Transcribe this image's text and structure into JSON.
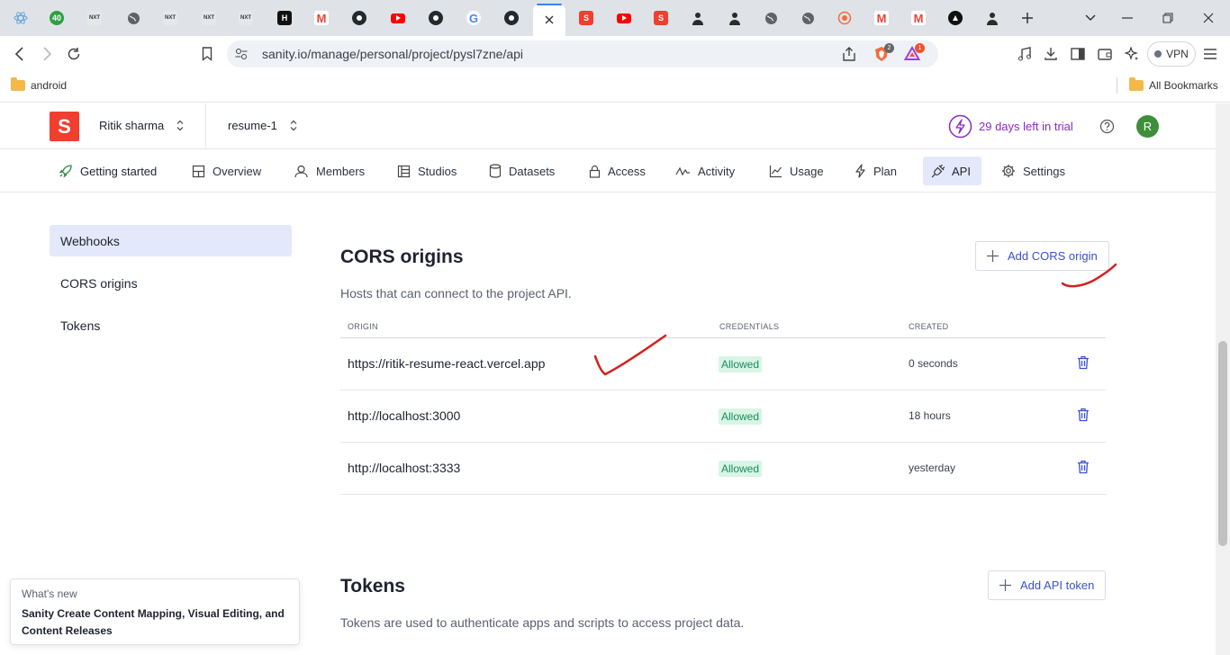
{
  "browser": {
    "tabs": [
      {
        "icon": "react-icon",
        "color": "#61a8d8"
      },
      {
        "icon": "counter-badge-icon",
        "color": "#2ea043",
        "text": "40"
      },
      {
        "icon": "next-favicon-icon",
        "color": "#e5e7eb",
        "text": "NXT"
      },
      {
        "icon": "globe-icon",
        "color": "#5f6368"
      },
      {
        "icon": "next-favicon-icon",
        "color": "#e5e7eb",
        "text": "NXT"
      },
      {
        "icon": "next-favicon-icon",
        "color": "#e5e7eb",
        "text": "NXT"
      },
      {
        "icon": "next-favicon-icon",
        "color": "#e5e7eb",
        "text": "NXT"
      },
      {
        "icon": "hackernoon-icon",
        "color": "#111111",
        "text": "H"
      },
      {
        "icon": "gmail-icon",
        "color": "#ea4335",
        "text": "M"
      },
      {
        "icon": "github-icon",
        "color": "#24292f"
      },
      {
        "icon": "youtube-icon",
        "color": "#ff0000"
      },
      {
        "icon": "github-icon",
        "color": "#24292f"
      },
      {
        "icon": "google-icon",
        "color": "#4285f4",
        "text": "G"
      },
      {
        "icon": "github-icon",
        "color": "#24292f"
      },
      {
        "icon": "close-icon",
        "color": "#333333",
        "active": true
      },
      {
        "icon": "sanity-icon",
        "color": "#f03e2f",
        "text": "S"
      },
      {
        "icon": "youtube-icon",
        "color": "#ff0000"
      },
      {
        "icon": "sanity-icon",
        "color": "#f03e2f",
        "text": "S"
      },
      {
        "icon": "person-icon",
        "color": "#2b2b2b"
      },
      {
        "icon": "person-icon",
        "color": "#2b2b2b"
      },
      {
        "icon": "globe-icon",
        "color": "#5f6368"
      },
      {
        "icon": "globe-icon",
        "color": "#5f6368"
      },
      {
        "icon": "brave-shield-icon",
        "color": "#f56b3d"
      },
      {
        "icon": "gmail-icon",
        "color": "#ea4335",
        "text": "M"
      },
      {
        "icon": "gmail-icon",
        "color": "#ea4335",
        "text": "M"
      },
      {
        "icon": "triangle-logo-icon",
        "color": "#111111"
      },
      {
        "icon": "person-icon",
        "color": "#2b2b2b"
      }
    ],
    "url": "sanity.io/manage/personal/project/pysl7zne/api",
    "brave_badge": "2",
    "rewards_badge": "1",
    "vpn_label": "VPN",
    "bookmarks": {
      "left": "android",
      "right": "All Bookmarks"
    }
  },
  "header": {
    "org": "Ritik sharma",
    "project": "resume-1",
    "trial": "29 days left in trial",
    "avatar_initial": "R"
  },
  "nav": [
    {
      "label": "Getting started",
      "icon": "rocket-icon"
    },
    {
      "label": "Overview",
      "icon": "overview-grid-icon"
    },
    {
      "label": "Members",
      "icon": "members-icon"
    },
    {
      "label": "Studios",
      "icon": "studios-icon"
    },
    {
      "label": "Datasets",
      "icon": "database-icon"
    },
    {
      "label": "Access",
      "icon": "lock-icon"
    },
    {
      "label": "Activity",
      "icon": "activity-icon"
    },
    {
      "label": "Usage",
      "icon": "chart-icon"
    },
    {
      "label": "Plan",
      "icon": "bolt-icon"
    },
    {
      "label": "API",
      "icon": "plug-icon",
      "active": true
    },
    {
      "label": "Settings",
      "icon": "gear-icon"
    }
  ],
  "sidebar": {
    "items": [
      {
        "label": "Webhooks",
        "active": true
      },
      {
        "label": "CORS origins"
      },
      {
        "label": "Tokens"
      }
    ]
  },
  "cors": {
    "title": "CORS origins",
    "description": "Hosts that can connect to the project API.",
    "add_button": "Add CORS origin",
    "columns": {
      "origin": "ORIGIN",
      "credentials": "CREDENTIALS",
      "created": "CREATED"
    },
    "rows": [
      {
        "origin": "https://ritik-resume-react.vercel.app",
        "credentials": "Allowed",
        "created": "0 seconds"
      },
      {
        "origin": "http://localhost:3000",
        "credentials": "Allowed",
        "created": "18 hours"
      },
      {
        "origin": "http://localhost:3333",
        "credentials": "Allowed",
        "created": "yesterday"
      }
    ]
  },
  "tokens": {
    "title": "Tokens",
    "description": "Tokens are used to authenticate apps and scripts to access project data.",
    "add_button": "Add API token"
  },
  "whats_new": {
    "kicker": "What's new",
    "title": "Sanity Create Content Mapping, Visual Editing, and Content Releases"
  },
  "colors": {
    "accent": "#3a4fd1",
    "sanity_red": "#f03e2f",
    "trial_purple": "#8c2bc4",
    "allowed_green": "#178e5a",
    "annotation_red": "#d42020"
  }
}
